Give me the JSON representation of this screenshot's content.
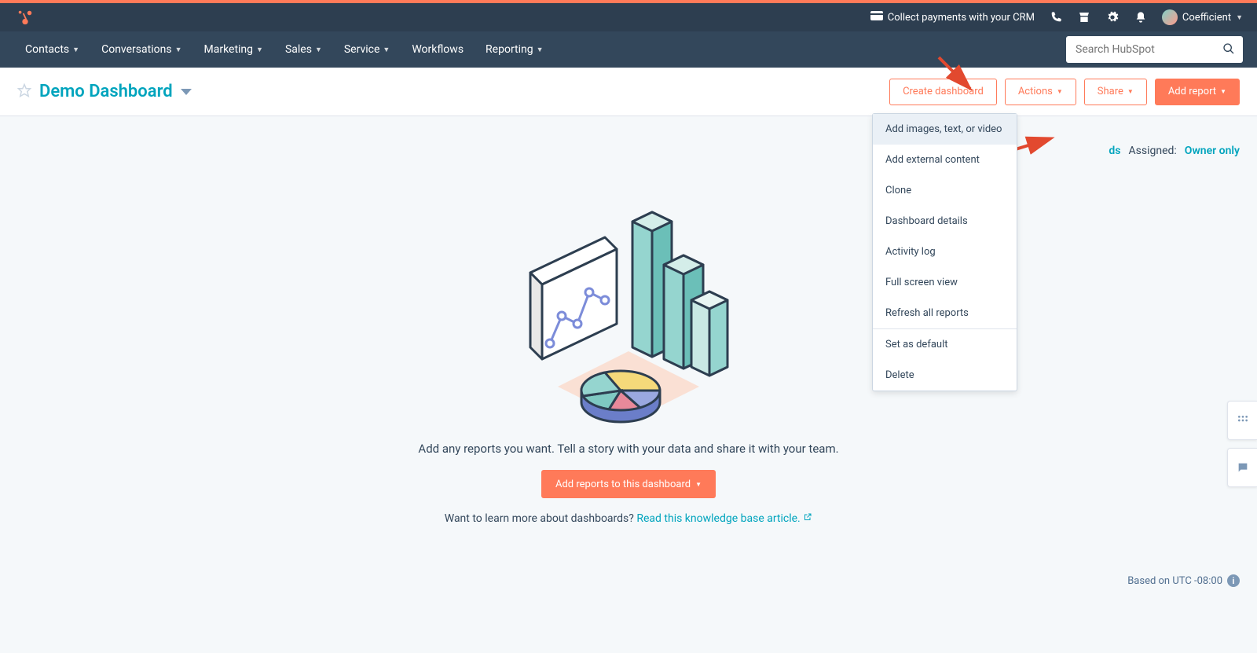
{
  "topbar": {
    "collect_label": "Collect payments with your CRM",
    "account_name": "Coefficient"
  },
  "nav": {
    "items": [
      {
        "label": "Contacts",
        "caret": true
      },
      {
        "label": "Conversations",
        "caret": true
      },
      {
        "label": "Marketing",
        "caret": true
      },
      {
        "label": "Sales",
        "caret": true
      },
      {
        "label": "Service",
        "caret": true
      },
      {
        "label": "Workflows",
        "caret": false
      },
      {
        "label": "Reporting",
        "caret": true
      }
    ]
  },
  "search": {
    "placeholder": "Search HubSpot"
  },
  "header": {
    "title": "Demo Dashboard",
    "create_label": "Create dashboard",
    "actions_label": "Actions",
    "share_label": "Share",
    "add_report_label": "Add report"
  },
  "dropdown": {
    "items": [
      "Add images, text, or video",
      "Add external content",
      "Clone",
      "Dashboard details",
      "Activity log",
      "Full screen view",
      "Refresh all reports",
      "Set as default",
      "Delete"
    ]
  },
  "meta": {
    "dashboards_link": "ds",
    "assigned_label": "Assigned:",
    "assigned_value": "Owner only"
  },
  "empty": {
    "text": "Add any reports you want. Tell a story with your data and share it with your team.",
    "button_label": "Add reports to this dashboard",
    "learn_prefix": "Want to learn more about dashboards? ",
    "learn_link": "Read this knowledge base article."
  },
  "footer": {
    "tz": "Based on UTC -08:00"
  }
}
